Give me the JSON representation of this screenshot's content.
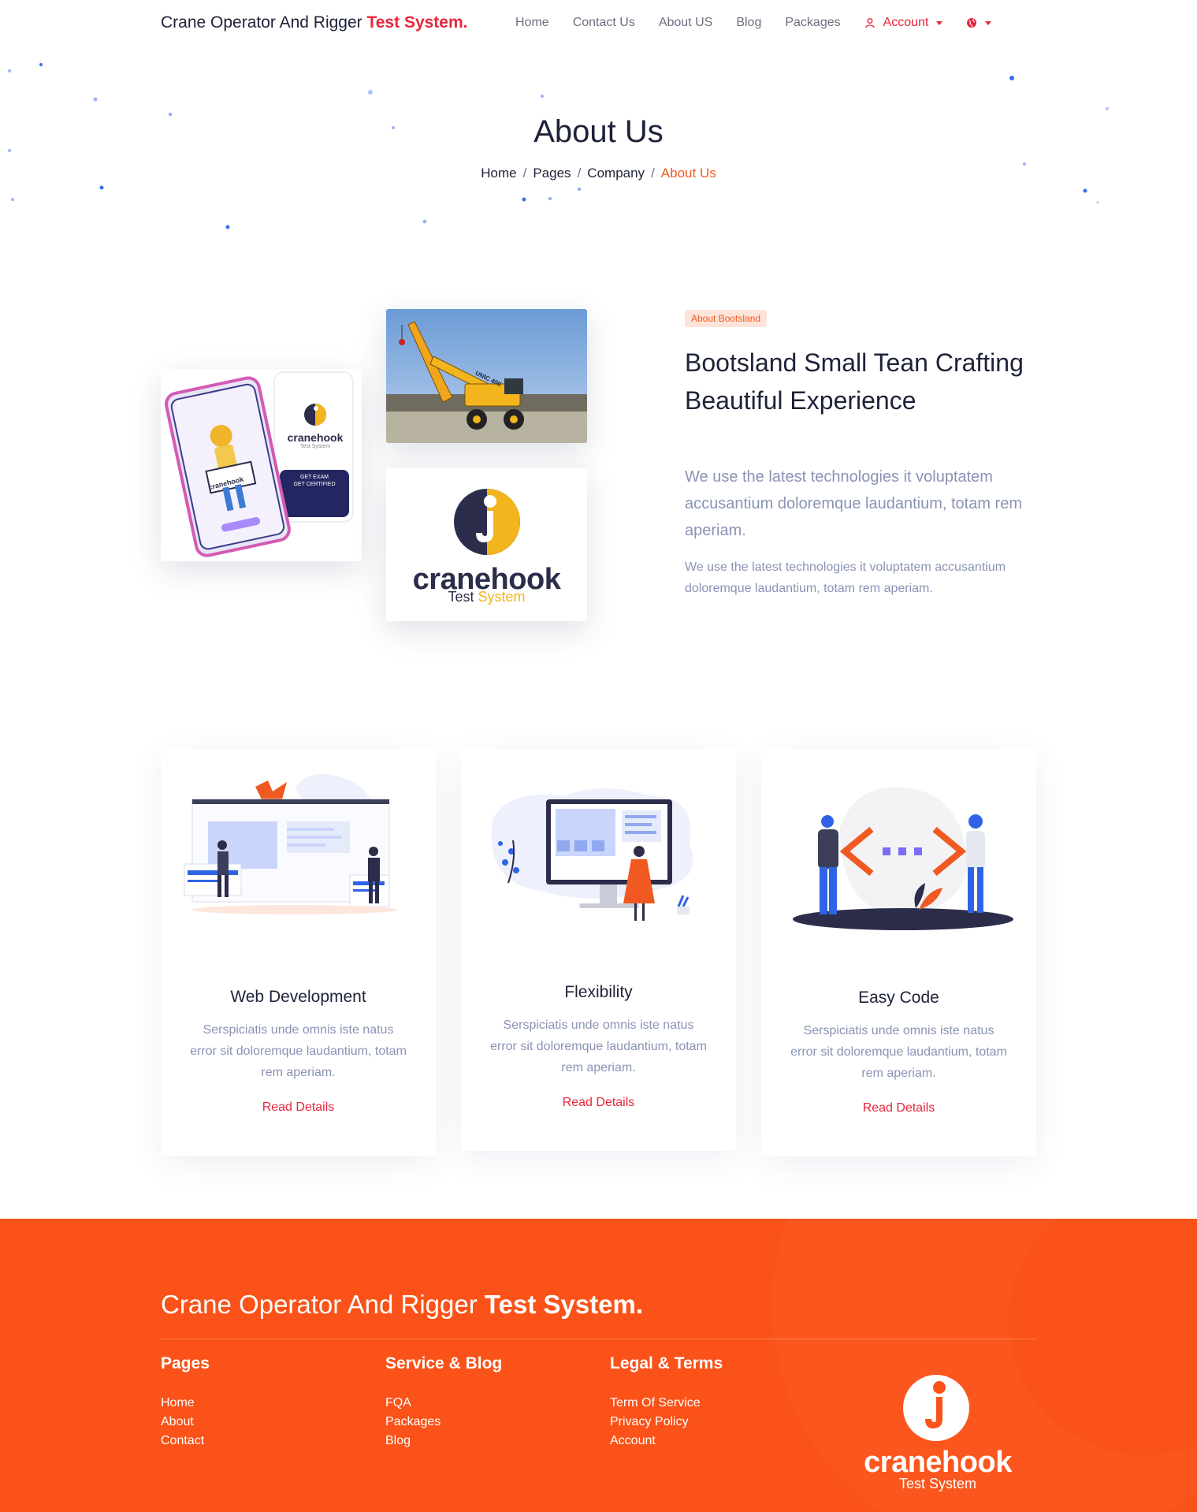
{
  "header": {
    "brand_prefix": "Crane Operator And Rigger",
    "brand_bold": "Test System.",
    "nav": [
      "Home",
      "Contact Us",
      "About US",
      "Blog",
      "Packages"
    ],
    "account_label": "Account"
  },
  "hero": {
    "title": "About Us",
    "breadcrumb": [
      "Home",
      "Pages",
      "Company",
      "About Us"
    ]
  },
  "about": {
    "badge": "About Bootsland",
    "title": "Bootsland Small Tean Crafting Beautiful Experience",
    "lead": "We use the latest technologies it voluptatem accusantium doloremque laudantium, totam rem aperiam.",
    "text": "We use the latest technologies it voluptatem accusantium doloremque laudantium, totam rem aperiam.",
    "logo_word": "cranehook",
    "logo_sub1": "Test",
    "logo_sub2": "System",
    "phone_logo": "cranehook",
    "phone_sub": "Test System",
    "phone_cta1": "GET EXAM",
    "phone_cta2": "GET CERTIFIED",
    "sign_text": "cranehook",
    "crane_text": "UNIC 400"
  },
  "features": [
    {
      "title": "Web Development",
      "text": "Serspiciatis unde omnis iste natus error sit doloremque laudantium, totam rem aperiam.",
      "link": "Read Details"
    },
    {
      "title": "Flexibility",
      "text": "Serspiciatis unde omnis iste natus error sit doloremque laudantium, totam rem aperiam.",
      "link": "Read Details"
    },
    {
      "title": "Easy Code",
      "text": "Serspiciatis unde omnis iste natus error sit doloremque laudantium, totam rem aperiam.",
      "link": "Read Details"
    }
  ],
  "footer": {
    "brand_prefix": "Crane Operator And Rigger",
    "brand_bold": "Test System.",
    "columns": [
      {
        "title": "Pages",
        "links": [
          "Home",
          "About",
          "Contact"
        ]
      },
      {
        "title": "Service & Blog",
        "links": [
          "FQA",
          "Packages",
          "Blog"
        ]
      },
      {
        "title": "Legal & Terms",
        "links": [
          "Term Of Service",
          "Privacy Policy",
          "Account"
        ]
      }
    ],
    "logo_word": "cranehook",
    "logo_sub": "Test System"
  },
  "colors": {
    "accent_red": "#e8253b",
    "accent_orange": "#fa5218",
    "logo_navy": "#2b2d4a",
    "logo_yellow": "#f2b51d"
  },
  "icons": [
    "user-icon",
    "globe-icon",
    "caret-down-icon"
  ]
}
